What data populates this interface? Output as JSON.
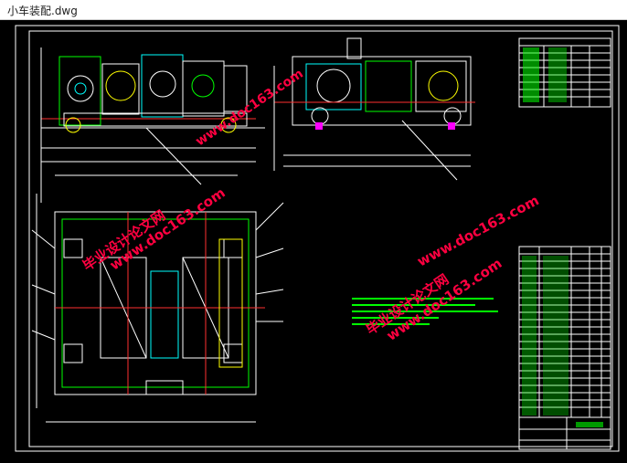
{
  "window": {
    "title": "小车装配.dwg"
  },
  "drawing": {
    "watermark_text_cn": "毕业设计论文网",
    "watermark_text_url": "www.doc163.com"
  },
  "colors": {
    "background": "#000000",
    "frame": "#ffffff",
    "green": "#00ff00",
    "red": "#ff2020",
    "cyan": "#00ffff",
    "yellow": "#ffff00",
    "magenta": "#ff00ff",
    "watermark": "#ff0040"
  }
}
